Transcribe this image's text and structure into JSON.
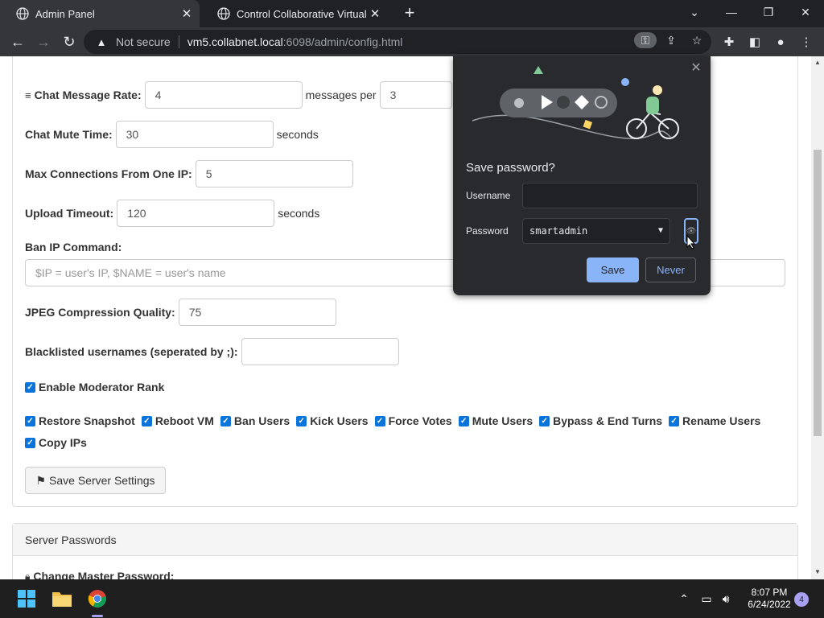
{
  "browser": {
    "tabs": [
      {
        "title": "Admin Panel",
        "active": true
      },
      {
        "title": "Control Collaborative Virtual Ma",
        "active": false
      }
    ],
    "security_label": "Not secure",
    "url_host": "vm5.collabnet.local",
    "url_rest": ":6098/admin/config.html"
  },
  "settings": {
    "chat_rate_label": "Chat Message Rate:",
    "chat_rate_value": "4",
    "chat_rate_mid": "messages per",
    "chat_rate_seconds": "3",
    "mute_time_label": "Chat Mute Time:",
    "mute_time_value": "30",
    "mute_time_suffix": "seconds",
    "max_conn_label": "Max Connections From One IP:",
    "max_conn_value": "5",
    "upload_timeout_label": "Upload Timeout:",
    "upload_timeout_value": "120",
    "upload_timeout_suffix": "seconds",
    "ban_cmd_label": "Ban IP Command:",
    "ban_cmd_placeholder": "$IP = user's IP, $NAME = user's name",
    "jpeg_label": "JPEG Compression Quality:",
    "jpeg_value": "75",
    "blacklist_label": "Blacklisted usernames (seperated by ;):",
    "blacklist_value": "",
    "moderator_label": "Enable Moderator Rank",
    "permissions": [
      "Restore Snapshot",
      "Reboot VM",
      "Ban Users",
      "Kick Users",
      "Force Votes",
      "Mute Users",
      "Bypass & End Turns",
      "Rename Users",
      "Copy IPs"
    ],
    "save_label": "Save Server Settings"
  },
  "passwords_panel": {
    "title": "Server Passwords",
    "master_label": "Change Master Password:"
  },
  "password_popup": {
    "title": "Save password?",
    "username_label": "Username",
    "username_value": "",
    "password_label": "Password",
    "password_value": "smartadmin",
    "save_label": "Save",
    "never_label": "Never"
  },
  "taskbar": {
    "time": "8:07 PM",
    "date": "6/24/2022",
    "notifications": "4"
  }
}
